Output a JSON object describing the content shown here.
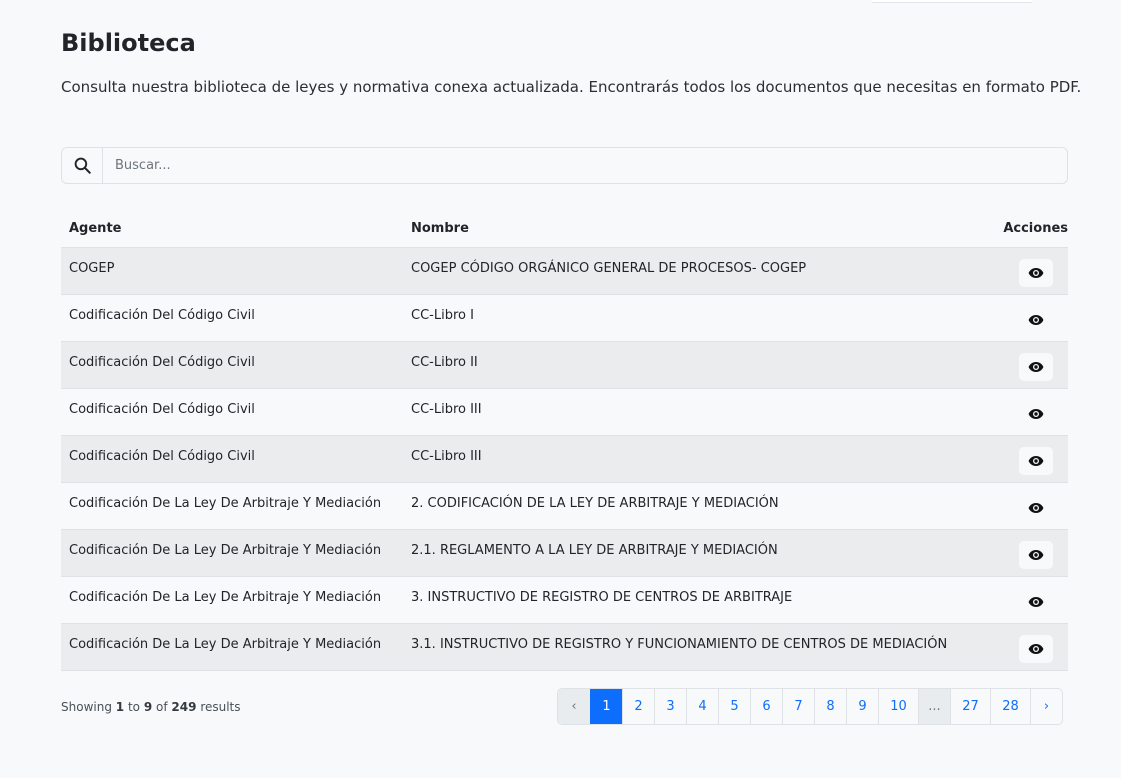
{
  "header": {
    "title": "Biblioteca",
    "description": "Consulta nuestra biblioteca de leyes y normativa conexa actualizada. Encontrarás todos los documentos que necesitas en formato PDF."
  },
  "search": {
    "placeholder": "Buscar...",
    "value": "",
    "icon": "search-icon"
  },
  "table": {
    "columns": [
      "Agente",
      "Nombre",
      "Acciones"
    ],
    "action_icon": "eye-icon",
    "rows": [
      {
        "agent": "COGEP",
        "name": "COGEP CÓDIGO ORGÁNICO GENERAL DE PROCESOS- COGEP"
      },
      {
        "agent": "Codificación Del Código Civil",
        "name": "CC-Libro I"
      },
      {
        "agent": "Codificación Del Código Civil",
        "name": "CC-Libro II"
      },
      {
        "agent": "Codificación Del Código Civil",
        "name": "CC-Libro III"
      },
      {
        "agent": "Codificación Del Código Civil",
        "name": "CC-Libro III"
      },
      {
        "agent": "Codificación De La Ley De Arbitraje Y Mediación",
        "name": "2. CODIFICACIÓN DE LA LEY DE ARBITRAJE Y MEDIACIÓN"
      },
      {
        "agent": "Codificación De La Ley De Arbitraje Y Mediación",
        "name": "2.1. REGLAMENTO A LA LEY DE ARBITRAJE Y MEDIACIÓN"
      },
      {
        "agent": "Codificación De La Ley De Arbitraje Y Mediación",
        "name": "3. INSTRUCTIVO DE REGISTRO DE CENTROS DE ARBITRAJE"
      },
      {
        "agent": "Codificación De La Ley De Arbitraje Y Mediación",
        "name": "3.1. INSTRUCTIVO DE REGISTRO Y FUNCIONAMIENTO DE CENTROS DE MEDIACIÓN"
      }
    ]
  },
  "summary": {
    "prefix": "Showing",
    "from": "1",
    "to_word": "to",
    "to": "9",
    "of_word": "of",
    "total": "249",
    "suffix": "results"
  },
  "pagination": {
    "prev": "‹",
    "next": "›",
    "ellipsis": "...",
    "current": "1",
    "pages": [
      "1",
      "2",
      "3",
      "4",
      "5",
      "6",
      "7",
      "8",
      "9",
      "10",
      "...",
      "27",
      "28"
    ]
  },
  "colors": {
    "accent": "#0d6efd",
    "stripe": "#ebecee",
    "background": "#f8f9fb"
  }
}
